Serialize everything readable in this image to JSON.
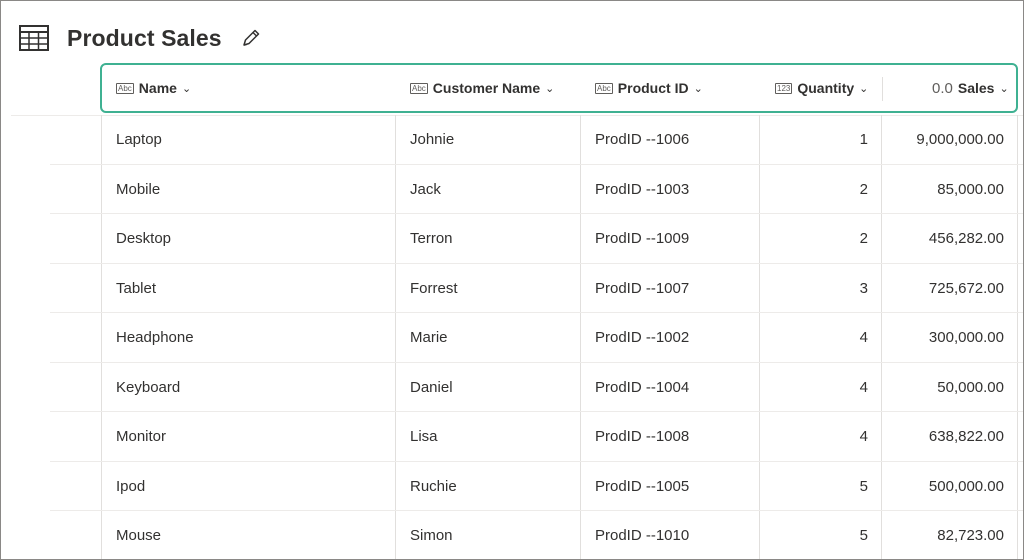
{
  "app": {
    "title": "Product Sales",
    "icons": {
      "table": "table-grid-icon",
      "edit": "pencil-edit-icon"
    }
  },
  "columns": [
    {
      "label": "Name",
      "type_icon": "Abc"
    },
    {
      "label": "Customer Name",
      "type_icon": "Abc"
    },
    {
      "label": "Product ID",
      "type_icon": "Abc"
    },
    {
      "label": "Quantity",
      "type_icon": "123"
    },
    {
      "label": "Sales",
      "type_icon": "0.0"
    }
  ],
  "rows": [
    {
      "name": "Laptop",
      "customer": "Johnie",
      "product_id": "ProdID --1006",
      "quantity": "1",
      "sales": "9,000,000.00"
    },
    {
      "name": "Mobile",
      "customer": "Jack",
      "product_id": "ProdID --1003",
      "quantity": "2",
      "sales": "85,000.00"
    },
    {
      "name": "Desktop",
      "customer": "Terron",
      "product_id": "ProdID --1009",
      "quantity": "2",
      "sales": "456,282.00"
    },
    {
      "name": "Tablet",
      "customer": "Forrest",
      "product_id": "ProdID --1007",
      "quantity": "3",
      "sales": "725,672.00"
    },
    {
      "name": "Headphone",
      "customer": "Marie",
      "product_id": "ProdID --1002",
      "quantity": "4",
      "sales": "300,000.00"
    },
    {
      "name": "Keyboard",
      "customer": "Daniel",
      "product_id": "ProdID --1004",
      "quantity": "4",
      "sales": "50,000.00"
    },
    {
      "name": "Monitor",
      "customer": "Lisa",
      "product_id": "ProdID --1008",
      "quantity": "4",
      "sales": "638,822.00"
    },
    {
      "name": "Ipod",
      "customer": "Ruchie",
      "product_id": "ProdID --1005",
      "quantity": "5",
      "sales": "500,000.00"
    },
    {
      "name": "Mouse",
      "customer": "Simon",
      "product_id": "ProdID --1010",
      "quantity": "5",
      "sales": "82,723.00"
    }
  ],
  "colors": {
    "header_highlight": "#3fb192",
    "grid_line": "#e1dfdd"
  }
}
